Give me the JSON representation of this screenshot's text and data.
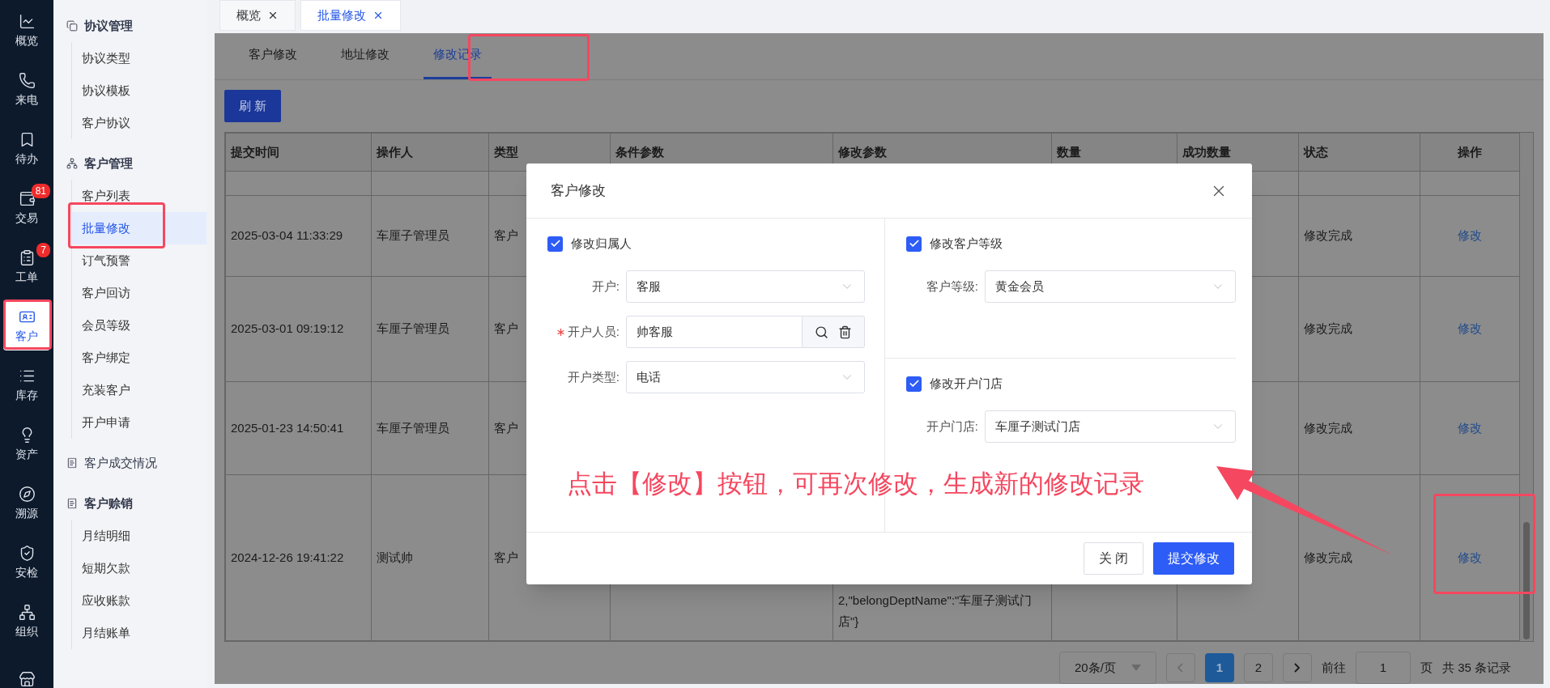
{
  "rail": [
    {
      "label": "概览",
      "selected": false
    },
    {
      "label": "来电",
      "selected": false
    },
    {
      "label": "待办",
      "selected": false
    },
    {
      "label": "交易",
      "selected": false,
      "badge": "81"
    },
    {
      "label": "工单",
      "selected": false,
      "badge": "7"
    },
    {
      "label": "客户",
      "selected": true
    },
    {
      "label": "库存",
      "selected": false
    },
    {
      "label": "资产",
      "selected": false
    },
    {
      "label": "溯源",
      "selected": false
    },
    {
      "label": "安检",
      "selected": false
    },
    {
      "label": "组织",
      "selected": false
    },
    {
      "selected": false
    }
  ],
  "submenu": [
    {
      "label": "协议管理",
      "kind": "group",
      "children": [
        {
          "label": "协议类型",
          "selected": false
        },
        {
          "label": "协议模板",
          "selected": false
        },
        {
          "label": "客户协议",
          "selected": false
        }
      ]
    },
    {
      "label": "客户管理",
      "kind": "group",
      "children": [
        {
          "label": "客户列表",
          "selected": false
        },
        {
          "label": "批量修改",
          "selected": true
        },
        {
          "label": "订气预警",
          "selected": false
        },
        {
          "label": "客户回访",
          "selected": false
        },
        {
          "label": "会员等级",
          "selected": false
        },
        {
          "label": "客户绑定",
          "selected": false
        },
        {
          "label": "充装客户",
          "selected": false
        },
        {
          "label": "开户申请",
          "selected": false
        }
      ]
    },
    {
      "label": "客户成交情况",
      "kind": "link"
    },
    {
      "label": "客户赊销",
      "kind": "group",
      "children": [
        {
          "label": "月结明细",
          "selected": false
        },
        {
          "label": "短期欠款",
          "selected": false
        },
        {
          "label": "应收账款",
          "selected": false
        },
        {
          "label": "月结账单",
          "selected": false
        }
      ]
    }
  ],
  "page_tabs": [
    {
      "label": "概览",
      "selected": false
    },
    {
      "label": "批量修改",
      "selected": true
    }
  ],
  "sub_tabs": [
    {
      "label": "客户修改",
      "selected": false
    },
    {
      "label": "地址修改",
      "selected": false
    },
    {
      "label": "修改记录",
      "selected": true
    }
  ],
  "refresh_button": "刷 新",
  "table": {
    "columns": [
      "提交时间",
      "操作人",
      "类型",
      "条件参数",
      "修改参数",
      "数量",
      "成功数量",
      "状态",
      "操作"
    ],
    "rows": [
      {
        "time": "2025-03-04 11:33:29",
        "operator": "车厘子管理员",
        "type": "客户",
        "status": "修改完成",
        "action": "修改"
      },
      {
        "time": "2025-03-01 09:19:12",
        "operator": "车厘子管理员",
        "type": "客户",
        "status": "修改完成",
        "action": "修改"
      },
      {
        "time": "2025-01-23 14:50:41",
        "operator": "车厘子管理员",
        "type": "客户",
        "status": "修改完成",
        "action": "修改"
      },
      {
        "time": "2024-12-26 19:41:22",
        "operator": "测试帅",
        "type": "客户",
        "params": "2,\"belongDeptName\":\"车厘子测试门店\"}",
        "status": "修改完成",
        "action": "修改"
      }
    ]
  },
  "pagination": {
    "page_size": "20条/页",
    "pages": [
      {
        "label": "1",
        "selected": true
      },
      {
        "label": "2",
        "selected": false
      }
    ],
    "goto_label": "前往",
    "goto_value": "1",
    "page_unit": "页",
    "total": "共 35 条记录"
  },
  "dialog": {
    "title": "客户修改",
    "sections": [
      {
        "label": "修改归属人",
        "checked": true,
        "fields": [
          {
            "label": "开户:",
            "kind": "select",
            "value": "客服",
            "required": false
          },
          {
            "label": "开户人员:",
            "kind": "lookup",
            "value": "帅客服",
            "required": true
          },
          {
            "label": "开户类型:",
            "kind": "select",
            "value": "电话",
            "required": false
          }
        ]
      },
      {
        "label": "修改客户等级",
        "checked": true,
        "fields": [
          {
            "label": "客户等级:",
            "kind": "select",
            "value": "黄金会员",
            "required": false
          }
        ]
      },
      {
        "label": "修改开户门店",
        "checked": true,
        "fields": [
          {
            "label": "开户门店:",
            "kind": "select",
            "value": "车厘子测试门店",
            "required": false
          }
        ]
      }
    ],
    "buttons": [
      {
        "label": "关 闭",
        "kind": "secondary"
      },
      {
        "label": "提交修改",
        "kind": "primary"
      }
    ]
  },
  "annotation": "点击【修改】按钮，可再次修改，生成新的修改记录"
}
